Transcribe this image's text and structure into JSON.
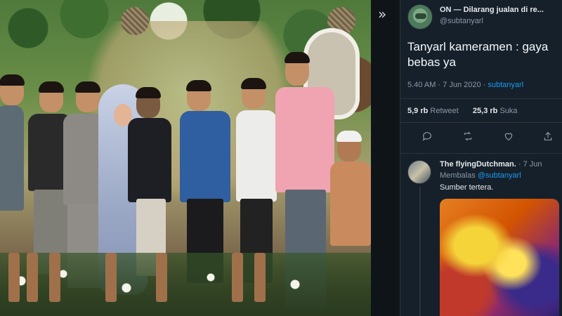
{
  "tweet": {
    "author_name": "ON — Dilarang jualan di re...",
    "author_handle": "@subtanyarl",
    "text": "Tanyarl kameramen : gaya bebas ya",
    "time": "5.40 AM",
    "date": "7 Jun 2020",
    "source": "subtanyarl",
    "retweets_count": "5,9 rb",
    "retweets_label": "Retweet",
    "likes_count": "25,3 rb",
    "likes_label": "Suka"
  },
  "reply": {
    "author_name": "The flyingDutchman.",
    "separator": "· 7 Jun",
    "replying_prefix": "Membalas",
    "replying_handle": "@subtanyarl",
    "text": "Sumber tertera."
  },
  "icons": {
    "collapse": "double-chevron-right-icon",
    "reply": "reply-bubble-icon",
    "retweet": "retweet-icon",
    "like": "heart-icon",
    "share": "share-icon"
  },
  "colors": {
    "background": "#15202b",
    "accent": "#1d9bf0",
    "muted_text": "#8b98a5"
  }
}
